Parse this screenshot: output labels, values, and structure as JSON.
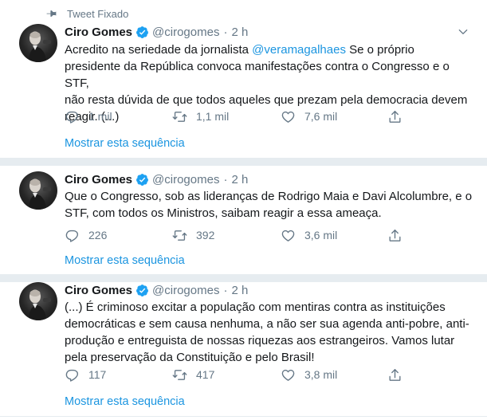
{
  "pinned_label": "Tweet Fixado",
  "tweets": [
    {
      "name": "Ciro Gomes",
      "handle": "@cirogomes",
      "separator": "·",
      "time": "2 h",
      "text_lines": [
        "Se o próprio",
        "presidente da República convoca manifestações contra o Congresso e o STF,",
        "não resta dúvida de que todos aqueles que prezam pela democracia devem",
        "reagir. (...)"
      ],
      "text_prefix": "Acredito na seriedade da jornalista",
      "mention": "@veramagalhaes",
      "replies": "1 mil",
      "retweets": "1,1 mil",
      "likes": "7,6 mil",
      "thread_link": "Mostrar esta sequência"
    },
    {
      "name": "Ciro Gomes",
      "handle": "@cirogomes",
      "separator": "·",
      "time": "2 h",
      "text_lines": [
        "Que o Congresso, sob as lideranças de Rodrigo Maia e Davi Alcolumbre, e o",
        "STF, com todos os Ministros, saibam reagir a essa ameaça."
      ],
      "replies": "226",
      "retweets": "392",
      "likes": "3,6 mil",
      "thread_link": "Mostrar esta sequência"
    },
    {
      "name": "Ciro Gomes",
      "handle": "@cirogomes",
      "separator": "·",
      "time": "2 h",
      "text_lines": [
        "(...) É criminoso excitar a população com mentiras contra as instituições",
        "democráticas e sem causa nenhuma, a não ser sua agenda anti-pobre, anti-",
        "produção e entreguista de nossas riquezas aos estrangeiros. Vamos lutar",
        "pela preservação da Constituição e pelo Brasil!"
      ],
      "replies": "117",
      "retweets": "417",
      "likes": "3,8 mil",
      "thread_link": "Mostrar esta sequência"
    }
  ],
  "colors": {
    "link": "#1b95e0",
    "verified": "#1da1f2",
    "muted": "#657786",
    "separator": "#e6ecf0"
  },
  "icons": [
    "pin-icon",
    "verified-icon",
    "chevron-down-icon",
    "reply-icon",
    "retweet-icon",
    "like-icon",
    "share-icon"
  ]
}
